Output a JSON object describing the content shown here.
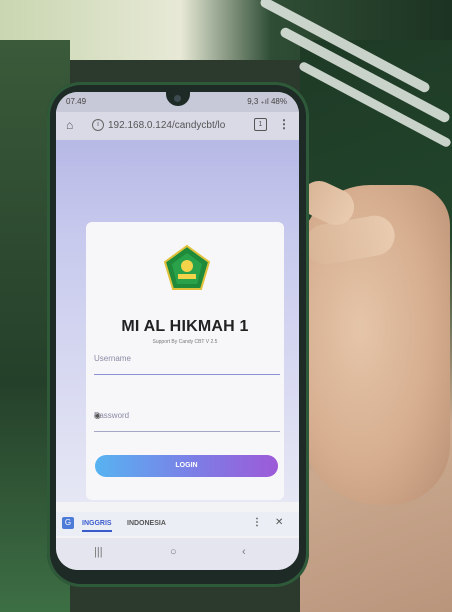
{
  "status_bar": {
    "time": "07.49",
    "right": "9,3 ₊ıl 48%"
  },
  "browser": {
    "url": "192.168.0.124/candycbt/lo",
    "tab_count": "1"
  },
  "login": {
    "school_name": "MI AL HIKMAH 1",
    "support_text": "Support By Candy CBT V 2.5",
    "username_placeholder": "Username",
    "password_placeholder": "Password",
    "login_button": "LOGIN"
  },
  "translate_bar": {
    "lang_active": "INGGRIS",
    "lang_other": "INDONESIA"
  },
  "colors": {
    "page_top": "#b7b9e6",
    "login_gradient_start": "#57b3f1",
    "login_gradient_end": "#9d5ad8"
  }
}
